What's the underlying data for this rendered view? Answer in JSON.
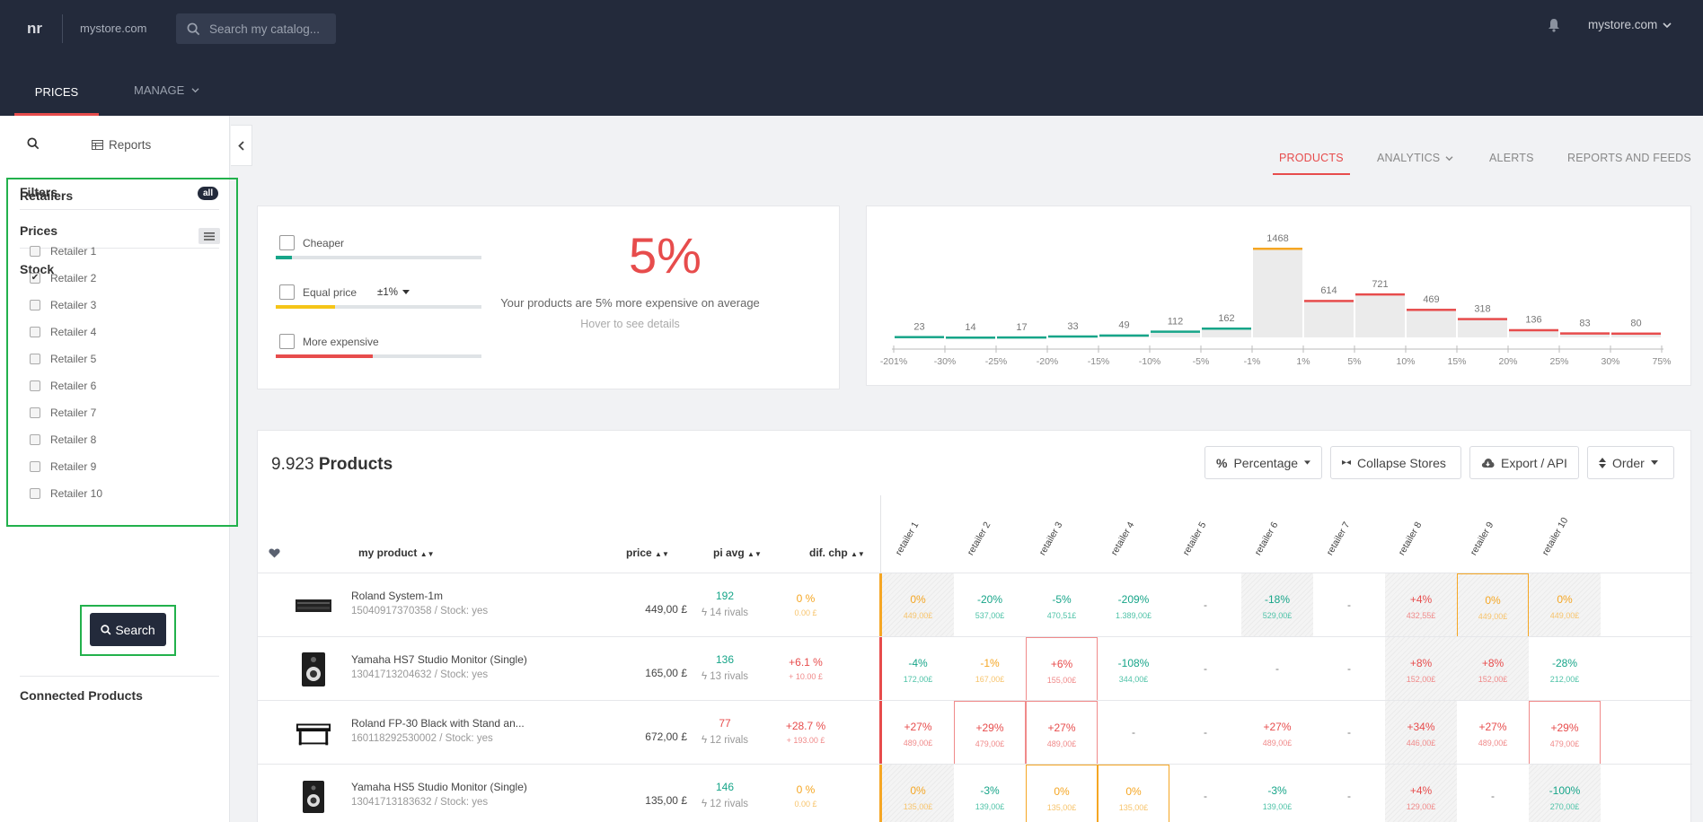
{
  "header": {
    "logo": "nr",
    "store": "mystore.com",
    "search_placeholder": "Search my catalog...",
    "account": "mystore.com",
    "nav": {
      "prices": "PRICES",
      "manage": "MANAGE"
    }
  },
  "sidebar": {
    "reports": "Reports",
    "sections": {
      "filters": "Filters",
      "prices": "Prices",
      "stock": "Stock"
    },
    "retailers_title": "Retailers",
    "all_badge": "all",
    "retailers": [
      {
        "label": "Retailer 1",
        "checked": false
      },
      {
        "label": "Retailer 2",
        "checked": true
      },
      {
        "label": "Retailer 3",
        "checked": false
      },
      {
        "label": "Retailer 4",
        "checked": false
      },
      {
        "label": "Retailer 5",
        "checked": false
      },
      {
        "label": "Retailer 6",
        "checked": false
      },
      {
        "label": "Retailer 7",
        "checked": false
      },
      {
        "label": "Retailer 8",
        "checked": false
      },
      {
        "label": "Retailer 9",
        "checked": false
      },
      {
        "label": "Retailer 10",
        "checked": false
      }
    ],
    "connected": "Connected Products",
    "search_button": "Search"
  },
  "tabs": {
    "products": "PRODUCTS",
    "analytics": "ANALYTICS",
    "alerts": "ALERTS",
    "reports": "REPORTS AND FEEDS"
  },
  "summary": {
    "cheaper": "Cheaper",
    "equal": "Equal price",
    "equal_range": "±1%",
    "expensive": "More expensive",
    "big_pct": "5%",
    "avg_text": "Your products are 5% more expensive on average",
    "hover_text": "Hover to see details",
    "bars": {
      "cheaper": 0.08,
      "equal": 0.29,
      "expensive": 0.47
    },
    "colors": {
      "cheaper": "#17a589",
      "equal": "#f5c518",
      "expensive": "#e74c4c"
    }
  },
  "chart_data": {
    "type": "bar",
    "categories": [
      "-201% to -30%",
      "-30% to -25%",
      "-25% to -20%",
      "-20% to -15%",
      "-15% to -10%",
      "-10% to -5%",
      "-5% to -1%",
      "-1% to 1%",
      "1% to 5%",
      "5% to 10%",
      "10% to 15%",
      "15% to 20%",
      "20% to 25%",
      "25% to 30%",
      "30% to 75%"
    ],
    "values": [
      23,
      14,
      17,
      33,
      49,
      112,
      162,
      1468,
      614,
      721,
      469,
      318,
      136,
      83,
      80
    ],
    "tick_labels": [
      "-201%",
      "-30%",
      "-25%",
      "-20%",
      "-15%",
      "-10%",
      "-5%",
      "-1%",
      "1%",
      "5%",
      "10%",
      "15%",
      "20%",
      "25%",
      "30%",
      "75%"
    ],
    "bar_colors": [
      "#17a589",
      "#17a589",
      "#17a589",
      "#17a589",
      "#17a589",
      "#17a589",
      "#17a589",
      "#f5a623",
      "#e74c4c",
      "#e74c4c",
      "#e74c4c",
      "#e74c4c",
      "#e74c4c",
      "#e74c4c",
      "#e74c4c"
    ],
    "ylim": [
      0,
      1468
    ]
  },
  "products": {
    "count": "9.923",
    "label": "Products",
    "buttons": {
      "percentage": "Percentage",
      "collapse": "Collapse Stores",
      "export": "Export / API",
      "order": "Order"
    },
    "columns": {
      "product": "my product",
      "price": "price",
      "pi": "pi avg",
      "dif": "dif. chp"
    },
    "retailer_headers": [
      "retailer 1",
      "retailer 2",
      "retailer 3",
      "retailer 4",
      "retailer 5",
      "retailer 6",
      "retailer 7",
      "retailer 8",
      "retailer 9",
      "retailer 10"
    ],
    "rows": [
      {
        "name": "Roland System-1m",
        "sku": "15040917370358 / Stock: yes",
        "price": "449,00 £",
        "pi": "192",
        "pi_color": "green",
        "rivals": "14 rivals",
        "dif": "0 %",
        "dif_sub": "0.00 £",
        "dif_color": "orange",
        "bar_color": "#f5a623",
        "cells": [
          {
            "v": "0%",
            "p": "449,00£",
            "c": "orange",
            "hatch": true,
            "box": ""
          },
          {
            "v": "-20%",
            "p": "537,00£",
            "c": "green",
            "hatch": false,
            "box": ""
          },
          {
            "v": "-5%",
            "p": "470,51£",
            "c": "green",
            "hatch": false,
            "box": ""
          },
          {
            "v": "-209%",
            "p": "1.389,00£",
            "c": "green",
            "hatch": false,
            "box": ""
          },
          {
            "v": "-",
            "p": "",
            "c": "dash",
            "hatch": false,
            "box": ""
          },
          {
            "v": "-18%",
            "p": "529,00£",
            "c": "green",
            "hatch": true,
            "box": ""
          },
          {
            "v": "-",
            "p": "",
            "c": "dash",
            "hatch": false,
            "box": ""
          },
          {
            "v": "+4%",
            "p": "432,55£",
            "c": "red",
            "hatch": true,
            "box": ""
          },
          {
            "v": "0%",
            "p": "449,00£",
            "c": "orange",
            "hatch": true,
            "box": "orange"
          },
          {
            "v": "0%",
            "p": "449,00£",
            "c": "orange",
            "hatch": true,
            "box": ""
          }
        ]
      },
      {
        "name": "Yamaha HS7 Studio Monitor (Single)",
        "sku": "13041713204632 / Stock: yes",
        "price": "165,00 £",
        "pi": "136",
        "pi_color": "green",
        "rivals": "13 rivals",
        "dif": "+6.1 %",
        "dif_sub": "+ 10.00 £",
        "dif_color": "red",
        "bar_color": "#e74c4c",
        "cells": [
          {
            "v": "-4%",
            "p": "172,00£",
            "c": "green",
            "hatch": false,
            "box": ""
          },
          {
            "v": "-1%",
            "p": "167,00£",
            "c": "orange",
            "hatch": false,
            "box": ""
          },
          {
            "v": "+6%",
            "p": "155,00£",
            "c": "red",
            "hatch": false,
            "box": "red"
          },
          {
            "v": "-108%",
            "p": "344,00£",
            "c": "green",
            "hatch": false,
            "box": ""
          },
          {
            "v": "-",
            "p": "",
            "c": "dash",
            "hatch": false,
            "box": ""
          },
          {
            "v": "-",
            "p": "",
            "c": "dash",
            "hatch": false,
            "box": ""
          },
          {
            "v": "-",
            "p": "",
            "c": "dash",
            "hatch": false,
            "box": ""
          },
          {
            "v": "+8%",
            "p": "152,00£",
            "c": "red",
            "hatch": true,
            "box": ""
          },
          {
            "v": "+8%",
            "p": "152,00£",
            "c": "red",
            "hatch": true,
            "box": ""
          },
          {
            "v": "-28%",
            "p": "212,00£",
            "c": "green",
            "hatch": false,
            "box": ""
          }
        ]
      },
      {
        "name": "Roland FP-30 Black with Stand an...",
        "sku": "160118292530002 / Stock: yes",
        "price": "672,00 £",
        "pi": "77",
        "pi_color": "red",
        "rivals": "12 rivals",
        "dif": "+28.7 %",
        "dif_sub": "+ 193.00 £",
        "dif_color": "red",
        "bar_color": "#e74c4c",
        "cells": [
          {
            "v": "+27%",
            "p": "489,00£",
            "c": "red",
            "hatch": false,
            "box": ""
          },
          {
            "v": "+29%",
            "p": "479,00£",
            "c": "red",
            "hatch": false,
            "box": "red"
          },
          {
            "v": "+27%",
            "p": "489,00£",
            "c": "red",
            "hatch": false,
            "box": "red"
          },
          {
            "v": "-",
            "p": "",
            "c": "dash",
            "hatch": false,
            "box": ""
          },
          {
            "v": "-",
            "p": "",
            "c": "dash",
            "hatch": false,
            "box": ""
          },
          {
            "v": "+27%",
            "p": "489,00£",
            "c": "red",
            "hatch": false,
            "box": ""
          },
          {
            "v": "-",
            "p": "",
            "c": "dash",
            "hatch": false,
            "box": ""
          },
          {
            "v": "+34%",
            "p": "446,00£",
            "c": "red",
            "hatch": true,
            "box": ""
          },
          {
            "v": "+27%",
            "p": "489,00£",
            "c": "red",
            "hatch": false,
            "box": ""
          },
          {
            "v": "+29%",
            "p": "479,00£",
            "c": "red",
            "hatch": false,
            "box": "red"
          }
        ]
      },
      {
        "name": "Yamaha HS5 Studio Monitor (Single)",
        "sku": "13041713183632 / Stock: yes",
        "price": "135,00 £",
        "pi": "146",
        "pi_color": "green",
        "rivals": "12 rivals",
        "dif": "0 %",
        "dif_sub": "0.00 £",
        "dif_color": "orange",
        "bar_color": "#f5a623",
        "cells": [
          {
            "v": "0%",
            "p": "135,00£",
            "c": "orange",
            "hatch": true,
            "box": ""
          },
          {
            "v": "-3%",
            "p": "139,00£",
            "c": "green",
            "hatch": false,
            "box": ""
          },
          {
            "v": "0%",
            "p": "135,00£",
            "c": "orange",
            "hatch": false,
            "box": "orange"
          },
          {
            "v": "0%",
            "p": "135,00£",
            "c": "orange",
            "hatch": false,
            "box": "orange"
          },
          {
            "v": "-",
            "p": "",
            "c": "dash",
            "hatch": false,
            "box": ""
          },
          {
            "v": "-3%",
            "p": "139,00£",
            "c": "green",
            "hatch": false,
            "box": ""
          },
          {
            "v": "-",
            "p": "",
            "c": "dash",
            "hatch": false,
            "box": ""
          },
          {
            "v": "+4%",
            "p": "129,00£",
            "c": "red",
            "hatch": true,
            "box": ""
          },
          {
            "v": "-",
            "p": "",
            "c": "dash",
            "hatch": false,
            "box": ""
          },
          {
            "v": "-100%",
            "p": "270,00£",
            "c": "green",
            "hatch": true,
            "box": ""
          }
        ]
      }
    ]
  }
}
